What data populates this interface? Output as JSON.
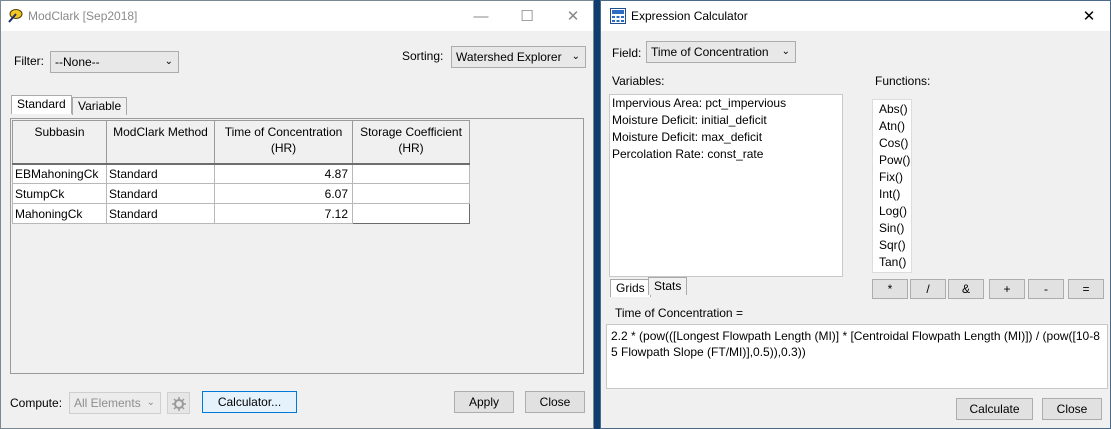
{
  "modclark": {
    "title": "ModClark [Sep2018]",
    "filter_label": "Filter:",
    "filter_value": "--None--",
    "sorting_label": "Sorting:",
    "sorting_value": "Watershed Explorer",
    "tabs": [
      "Standard",
      "Variable"
    ],
    "columns": [
      "Subbasin",
      "ModClark Method",
      "Time of Concentration\n(HR)",
      "Storage Coefficient\n(HR)"
    ],
    "rows": [
      {
        "subbasin": "EBMahoningCk",
        "method": "Standard",
        "toc": "4.87",
        "storage": ""
      },
      {
        "subbasin": "StumpCk",
        "method": "Standard",
        "toc": "6.07",
        "storage": ""
      },
      {
        "subbasin": "MahoningCk",
        "method": "Standard",
        "toc": "7.12",
        "storage": ""
      }
    ],
    "compute_label": "Compute:",
    "compute_value": "All Elements",
    "calculator_button": "Calculator...",
    "apply_button": "Apply",
    "close_button": "Close"
  },
  "calc": {
    "title": "Expression Calculator",
    "field_label": "Field:",
    "field_value": "Time of Concentration",
    "variables_label": "Variables:",
    "variables": [
      "Impervious Area: pct_impervious",
      "Moisture Deficit: initial_deficit",
      "Moisture Deficit: max_deficit",
      "Percolation Rate: const_rate"
    ],
    "functions_label": "Functions:",
    "functions": [
      "Abs()",
      "Atn()",
      "Cos()",
      "Pow()",
      "Fix()",
      "Int()",
      "Log()",
      "Sin()",
      "Sqr()",
      "Tan()"
    ],
    "tabs": [
      "Grids",
      "Stats"
    ],
    "operators": [
      "*",
      "/",
      "&",
      "+",
      "-",
      "="
    ],
    "expression_label": "Time of Concentration =",
    "expression": "2.2 * (pow(([Longest Flowpath Length (MI)] * [Centroidal Flowpath Length (MI)]) / (pow([10-85 Flowpath Slope (FT/MI)],0.5)),0.3))",
    "calculate_button": "Calculate",
    "close_button": "Close"
  },
  "icons": {
    "app_icon": "hms-wand-icon",
    "calc_icon": "calculator-grid-icon",
    "compute_icon": "compute-gear-icon"
  },
  "colors": {
    "desktop": "#0f3d6e",
    "focus_border": "#0078d7"
  }
}
